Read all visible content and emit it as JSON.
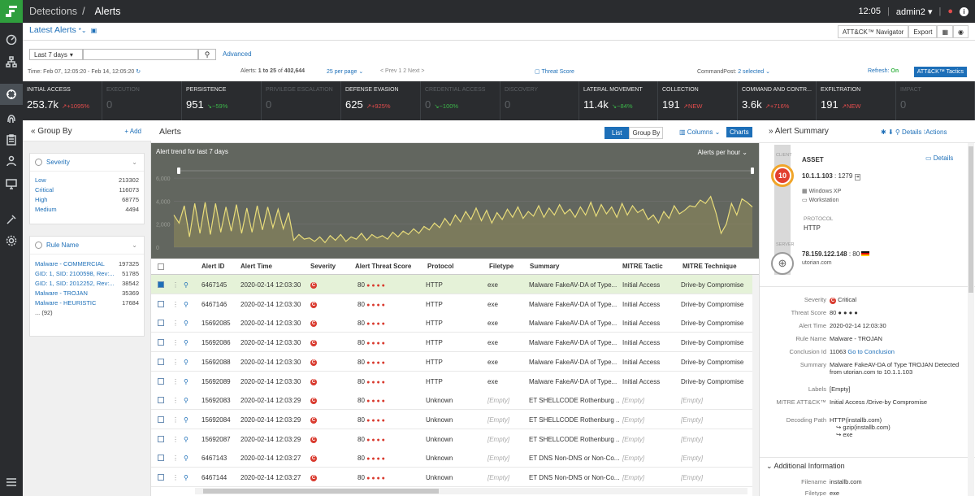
{
  "topbar": {
    "section": "Detections",
    "page": "Alerts",
    "time": "12:05",
    "user": "admin2"
  },
  "subbar": {
    "view_name": "Latest Alerts",
    "navigator_btn": "ATT&CK™ Navigator",
    "export_btn": "Export"
  },
  "filters": {
    "range": "Last 7 days",
    "advanced": "Advanced"
  },
  "info": {
    "time_label": "Time: Feb 07, 12:05:20 - Feb 14, 12:05:20",
    "alerts_prefix": "Alerts:",
    "alerts_range": "1 to 25",
    "alerts_of": "of",
    "alerts_total": "402,644",
    "per_page": "25 per page",
    "pager": "< Prev  1  2  Next >",
    "threat_score": "Threat Score",
    "commandpost_label": "CommandPost:",
    "commandpost_value": "2 selected",
    "refresh_label": "Refresh:",
    "refresh_value": "On",
    "tactics_btn": "ATT&CK™ Tactics"
  },
  "tactics": [
    {
      "name": "INITIAL ACCESS",
      "value": "253.7k",
      "delta": "↗+1095%",
      "dir": "up",
      "dim": false
    },
    {
      "name": "EXECUTION",
      "value": "0",
      "delta": "",
      "dir": "",
      "dim": true
    },
    {
      "name": "PERSISTENCE",
      "value": "951",
      "delta": "↘−59%",
      "dir": "dn",
      "dim": false
    },
    {
      "name": "PRIVILEGE ESCALATION",
      "value": "0",
      "delta": "",
      "dir": "",
      "dim": true
    },
    {
      "name": "DEFENSE EVASION",
      "value": "625",
      "delta": "↗+925%",
      "dir": "up",
      "dim": false
    },
    {
      "name": "CREDENTIAL ACCESS",
      "value": "0",
      "delta": "↘−100%",
      "dir": "dn",
      "dim": true
    },
    {
      "name": "DISCOVERY",
      "value": "0",
      "delta": "",
      "dir": "",
      "dim": true
    },
    {
      "name": "LATERAL MOVEMENT",
      "value": "11.4k",
      "delta": "↘−84%",
      "dir": "dn",
      "dim": false
    },
    {
      "name": "COLLECTION",
      "value": "191",
      "delta": "↗NEW",
      "dir": "up",
      "dim": false
    },
    {
      "name": "COMMAND AND CONTR...",
      "value": "3.6k",
      "delta": "↗+716%",
      "dir": "up",
      "dim": false
    },
    {
      "name": "EXFILTRATION",
      "value": "191",
      "delta": "↗NEW",
      "dir": "up",
      "dim": false
    },
    {
      "name": "IMPACT",
      "value": "0",
      "delta": "",
      "dir": "",
      "dim": true
    }
  ],
  "groupby": {
    "title": "Group By",
    "add": "Add",
    "severity": {
      "title": "Severity",
      "rows": [
        [
          "Low",
          "213302"
        ],
        [
          "Critical",
          "116073"
        ],
        [
          "High",
          "68775"
        ],
        [
          "Medium",
          "4494"
        ]
      ]
    },
    "rule": {
      "title": "Rule Name",
      "rows": [
        [
          "Malware - COMMERCIAL",
          "197325"
        ],
        [
          "GID: 1, SID: 2100598, Rev:...",
          "51785"
        ],
        [
          "GID: 1, SID: 2012252, Rev:...",
          "38542"
        ],
        [
          "Malware - TROJAN",
          "35369"
        ],
        [
          "Malware - HEURISTIC",
          "17684"
        ]
      ],
      "more": "... (92)"
    }
  },
  "alerts": {
    "title": "Alerts",
    "list_btn": "List",
    "groupby_btn": "Group By",
    "columns_btn": "Columns",
    "charts_btn": "Charts",
    "chart_title": "Alert trend for last 7 days",
    "chart_interval": "Alerts per hour",
    "columns": [
      "Alert ID",
      "Alert Time",
      "Severity",
      "Alert Threat Score",
      "Protocol",
      "Filetype",
      "Summary",
      "MITRE Tactic",
      "MITRE Technique"
    ]
  },
  "chart_data": {
    "type": "area",
    "title": "Alert trend for last 7 days",
    "y_ticks": [
      "6,000",
      "4,000",
      "2,000",
      "0"
    ],
    "ylim": [
      0,
      6500
    ],
    "values": [
      2800,
      2100,
      3600,
      900,
      3800,
      1200,
      3900,
      1100,
      3800,
      1300,
      3500,
      1400,
      3700,
      1200,
      3400,
      1300,
      3600,
      1500,
      3500,
      1700,
      3300,
      1600,
      3000,
      600,
      1100,
      700,
      800,
      500,
      900,
      400,
      1000,
      600,
      1100,
      500,
      900,
      700,
      1200,
      600,
      1100,
      800,
      1000,
      700,
      1300,
      900,
      1400,
      1100,
      1600,
      1200,
      1800,
      1500,
      2100,
      1700,
      2500,
      1900,
      2800,
      2200,
      3100,
      2400,
      3400,
      2300,
      3200,
      2100,
      3000,
      2400,
      3300,
      2600,
      3500,
      2500,
      3100,
      2700,
      3600,
      2600,
      3400,
      2800,
      3700,
      2900,
      3300,
      2600,
      3500,
      2800,
      3900,
      2700,
      3700,
      2900,
      3500,
      2600,
      3800,
      2800,
      3600,
      3000,
      3300,
      2400,
      2800,
      2100,
      3100,
      2500,
      3600,
      2900,
      3200,
      3600,
      3500,
      4100,
      3800,
      4400,
      3000,
      1200,
      2000,
      3800,
      2800,
      4200,
      3900,
      3500
    ]
  },
  "rows": [
    {
      "id": "6467145",
      "time": "2020-02-14 12:03:30",
      "sev": "C",
      "score": "80",
      "stars": "● ● ● ●",
      "proto": "HTTP",
      "ftype": "exe",
      "summary": "Malware FakeAV-DA of Type...",
      "tactic": "Initial Access",
      "tech": "Drive-by Compromise",
      "sel": true
    },
    {
      "id": "6467146",
      "time": "2020-02-14 12:03:30",
      "sev": "C",
      "score": "80",
      "stars": "● ● ● ●",
      "proto": "HTTP",
      "ftype": "exe",
      "summary": "Malware FakeAV-DA of Type...",
      "tactic": "Initial Access",
      "tech": "Drive-by Compromise",
      "sel": false
    },
    {
      "id": "15692085",
      "time": "2020-02-14 12:03:30",
      "sev": "C",
      "score": "80",
      "stars": "● ● ● ●",
      "proto": "HTTP",
      "ftype": "exe",
      "summary": "Malware FakeAV-DA of Type...",
      "tactic": "Initial Access",
      "tech": "Drive-by Compromise",
      "sel": false
    },
    {
      "id": "15692086",
      "time": "2020-02-14 12:03:30",
      "sev": "C",
      "score": "80",
      "stars": "● ● ● ●",
      "proto": "HTTP",
      "ftype": "exe",
      "summary": "Malware FakeAV-DA of Type...",
      "tactic": "Initial Access",
      "tech": "Drive-by Compromise",
      "sel": false
    },
    {
      "id": "15692088",
      "time": "2020-02-14 12:03:30",
      "sev": "C",
      "score": "80",
      "stars": "● ● ● ●",
      "proto": "HTTP",
      "ftype": "exe",
      "summary": "Malware FakeAV-DA of Type...",
      "tactic": "Initial Access",
      "tech": "Drive-by Compromise",
      "sel": false
    },
    {
      "id": "15692089",
      "time": "2020-02-14 12:03:30",
      "sev": "C",
      "score": "80",
      "stars": "● ● ● ●",
      "proto": "HTTP",
      "ftype": "exe",
      "summary": "Malware FakeAV-DA of Type...",
      "tactic": "Initial Access",
      "tech": "Drive-by Compromise",
      "sel": false
    },
    {
      "id": "15692083",
      "time": "2020-02-14 12:03:29",
      "sev": "C",
      "score": "80",
      "stars": "● ● ● ●",
      "proto": "Unknown",
      "ftype": "[Empty]",
      "summary": "ET SHELLCODE Rothenburg ...",
      "tactic": "[Empty]",
      "tech": "[Empty]",
      "sel": false
    },
    {
      "id": "15692084",
      "time": "2020-02-14 12:03:29",
      "sev": "C",
      "score": "80",
      "stars": "● ● ● ●",
      "proto": "Unknown",
      "ftype": "[Empty]",
      "summary": "ET SHELLCODE Rothenburg ...",
      "tactic": "[Empty]",
      "tech": "[Empty]",
      "sel": false
    },
    {
      "id": "15692087",
      "time": "2020-02-14 12:03:29",
      "sev": "C",
      "score": "80",
      "stars": "● ● ● ●",
      "proto": "Unknown",
      "ftype": "[Empty]",
      "summary": "ET SHELLCODE Rothenburg ...",
      "tactic": "[Empty]",
      "tech": "[Empty]",
      "sel": false
    },
    {
      "id": "6467143",
      "time": "2020-02-14 12:03:27",
      "sev": "C",
      "score": "80",
      "stars": "● ● ● ●",
      "proto": "Unknown",
      "ftype": "[Empty]",
      "summary": "ET DNS Non-DNS or Non-Co...",
      "tactic": "[Empty]",
      "tech": "[Empty]",
      "sel": false
    },
    {
      "id": "6467144",
      "time": "2020-02-14 12:03:27",
      "sev": "C",
      "score": "80",
      "stars": "● ● ● ●",
      "proto": "Unknown",
      "ftype": "[Empty]",
      "summary": "ET DNS Non-DNS or Non-Co...",
      "tactic": "[Empty]",
      "tech": "[Empty]",
      "sel": false
    }
  ],
  "summary": {
    "title": "Alert Summary",
    "details": "Details",
    "actions": "Actions",
    "client_label": "CLIENT",
    "server_label": "SERVER",
    "score": "10",
    "asset": "ASSET",
    "asset_details": "Details",
    "client_ip": "10.1.1.103",
    "client_port": ": 1279",
    "os": "Windows XP",
    "device": "Workstation",
    "protocol_label": "PROTOCOL",
    "protocol": "HTTP",
    "server_ip": "78.159.122.148",
    "server_port": ": 80",
    "server_host": "utorian.com",
    "fields": [
      [
        "Severity",
        "Critical"
      ],
      [
        "Threat Score",
        "80 ● ● ● ●"
      ],
      [
        "Alert Time",
        "2020-02-14 12:03:30"
      ],
      [
        "Rule Name",
        "Malware - TROJAN"
      ],
      [
        "Conclusion Id",
        "11063"
      ],
      [
        "Summary",
        "Malware FakeAV-DA of Type TROJAN Detected from utorian.com to 10.1.1.103"
      ],
      [
        "Labels",
        "[Empty]"
      ],
      [
        "MITRE ATT&CK™",
        "Initial Access  /Drive-by Compromise"
      ],
      [
        "Decoding Path",
        "HTTP(installb.com)"
      ]
    ],
    "conclusion_link": "Go to Conclusion",
    "decode_1": "↪ gzip(installb.com)",
    "decode_2": "↪ exe",
    "additional": "Additional Information",
    "filename_label": "Filename",
    "filename": "installb.com",
    "filetype_label": "Filetype",
    "filetype": "exe"
  }
}
